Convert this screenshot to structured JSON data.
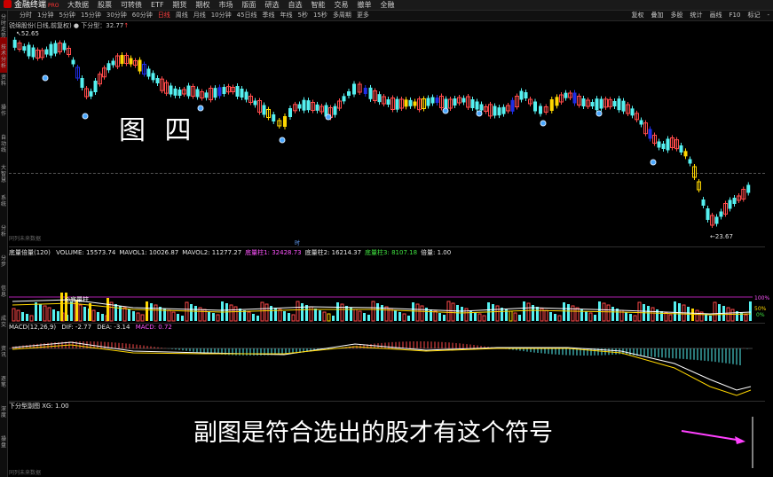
{
  "app": {
    "name": "金融终端",
    "tag": "PRO"
  },
  "menu": [
    "大数据",
    "股票",
    "可转债",
    "ETF",
    "期货",
    "期权",
    "市场",
    "版面",
    "研选",
    "自选",
    "智能",
    "交易",
    "撤单",
    "全融"
  ],
  "periods": [
    "分时",
    "1分钟",
    "5分钟",
    "15分钟",
    "30分钟",
    "60分钟",
    "日线",
    "周线",
    "月线",
    "10分钟",
    "45日线",
    "季线",
    "年线",
    "5秒",
    "15秒",
    "多周期",
    "更多"
  ],
  "active_period": "日线",
  "right_tools": [
    "复权",
    "叠加",
    "多股",
    "统计",
    "画线",
    "F10",
    "标记",
    "-"
  ],
  "left_labels": [
    "分时走势",
    "技术分析",
    "资料",
    "操作",
    "自动线",
    "大智慧",
    "系统",
    "分析",
    "分步",
    "信息",
    "成交",
    "资讯",
    "逐笔",
    "深度",
    "操盘"
  ],
  "main_panel": {
    "title": "锐绵股份(日线,前复权)",
    "indicator": "下分型：32.77",
    "high_label": "52.65",
    "low_label": "23.67",
    "footer": "同列未来数据",
    "center_mark": "时"
  },
  "volume_panel": {
    "title": "底量倍量(120)",
    "items": [
      {
        "label": "VOLUME: 15573.74",
        "color": "white"
      },
      {
        "label": "MAVOL1: 10026.87",
        "color": "white"
      },
      {
        "label": "MAVOL2: 11277.27",
        "color": "white"
      },
      {
        "label": "底量柱1: 32428.73",
        "color": "mag"
      },
      {
        "label": "底量柱2: 16214.37",
        "color": "white"
      },
      {
        "label": "底量柱3: 8107.18",
        "color": "grn"
      },
      {
        "label": "倍量: 1.00",
        "color": "white"
      }
    ],
    "badge": "底量柱",
    "pct_labels": [
      "100%",
      "50%",
      "0%"
    ]
  },
  "macd_panel": {
    "title": "MACD(12,26,9)",
    "dif": "DIF: -2.77",
    "dea": "DEA: -3.14",
    "macd": "MACD: 0.72"
  },
  "sub_panel": {
    "title": "下分型副图 XG: 1.00",
    "footer": "同列未来数据"
  },
  "overlays": {
    "label1": "图 四",
    "label2": "副图是符合选出的股才有这个符号"
  },
  "colors": {
    "up": "#ff4a4a",
    "down": "#55f0f0",
    "signal_bar": "#ffd700",
    "signal_blue": "#1e2ee6",
    "volume_top_line": "#b020b0",
    "arrow": "#ff40ff"
  }
}
